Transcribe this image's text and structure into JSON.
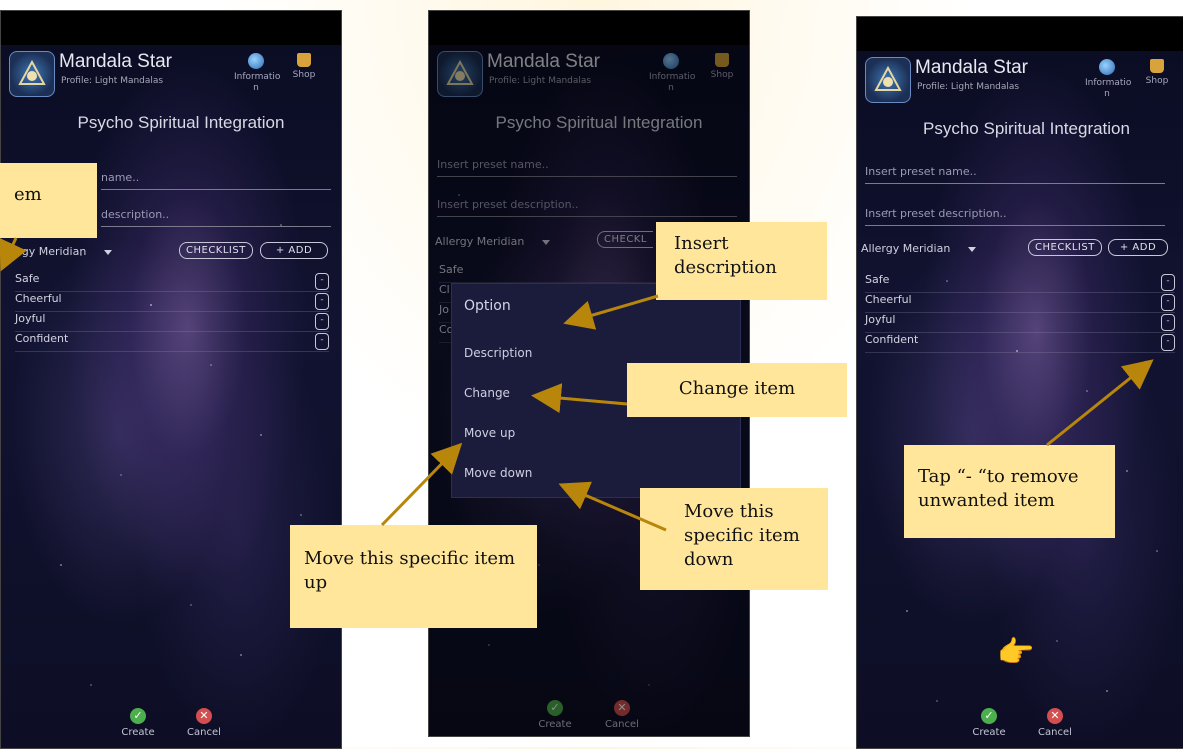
{
  "app": {
    "title": "Mandala Star",
    "profile": "Profile: Light Mandalas",
    "info_label": "Informatio\nn",
    "shop_label": "Shop",
    "screen_title": "Psycho Spiritual Integration"
  },
  "form": {
    "preset_name_placeholder": "Insert preset name..",
    "preset_description_placeholder": "Insert preset description..",
    "panel1_name_fragment": "name..",
    "panel1_description_fragment": "description..",
    "selector_value": "Allergy Meridian",
    "panel1_selector_fragment": "Allergy Meridian",
    "panel2_checklist_fragment": "CHECKL",
    "checklist_label": "CHECKLIST",
    "add_label": "+ ADD",
    "panel2_fragment_a": "Cl",
    "panel2_fragment_b": "Jo",
    "panel2_fragment_c": "Co"
  },
  "items": [
    "Safe",
    "Cheerful",
    "Joyful",
    "Confident"
  ],
  "minus_symbol": "-",
  "bottom": {
    "create_label": "Create",
    "cancel_label": "Cancel",
    "create_symbol": "✓",
    "cancel_symbol": "✕"
  },
  "dialog": {
    "title": "Option",
    "options": [
      "Description",
      "Change",
      "Move up",
      "Move down"
    ]
  },
  "callouts": {
    "panel1_fragment": "em",
    "insert_description": "Insert description",
    "change_item": "Change item",
    "move_up": "Move this specific item up",
    "move_down": "Move this specific item down",
    "remove_item": "Tap “- “to remove unwanted item"
  },
  "hand_emoji": "👉",
  "colors": {
    "callout_bg": "#ffe69a",
    "arrow": "#b8860b",
    "accent_green": "#4cae4c",
    "accent_red": "#d34f4f"
  }
}
